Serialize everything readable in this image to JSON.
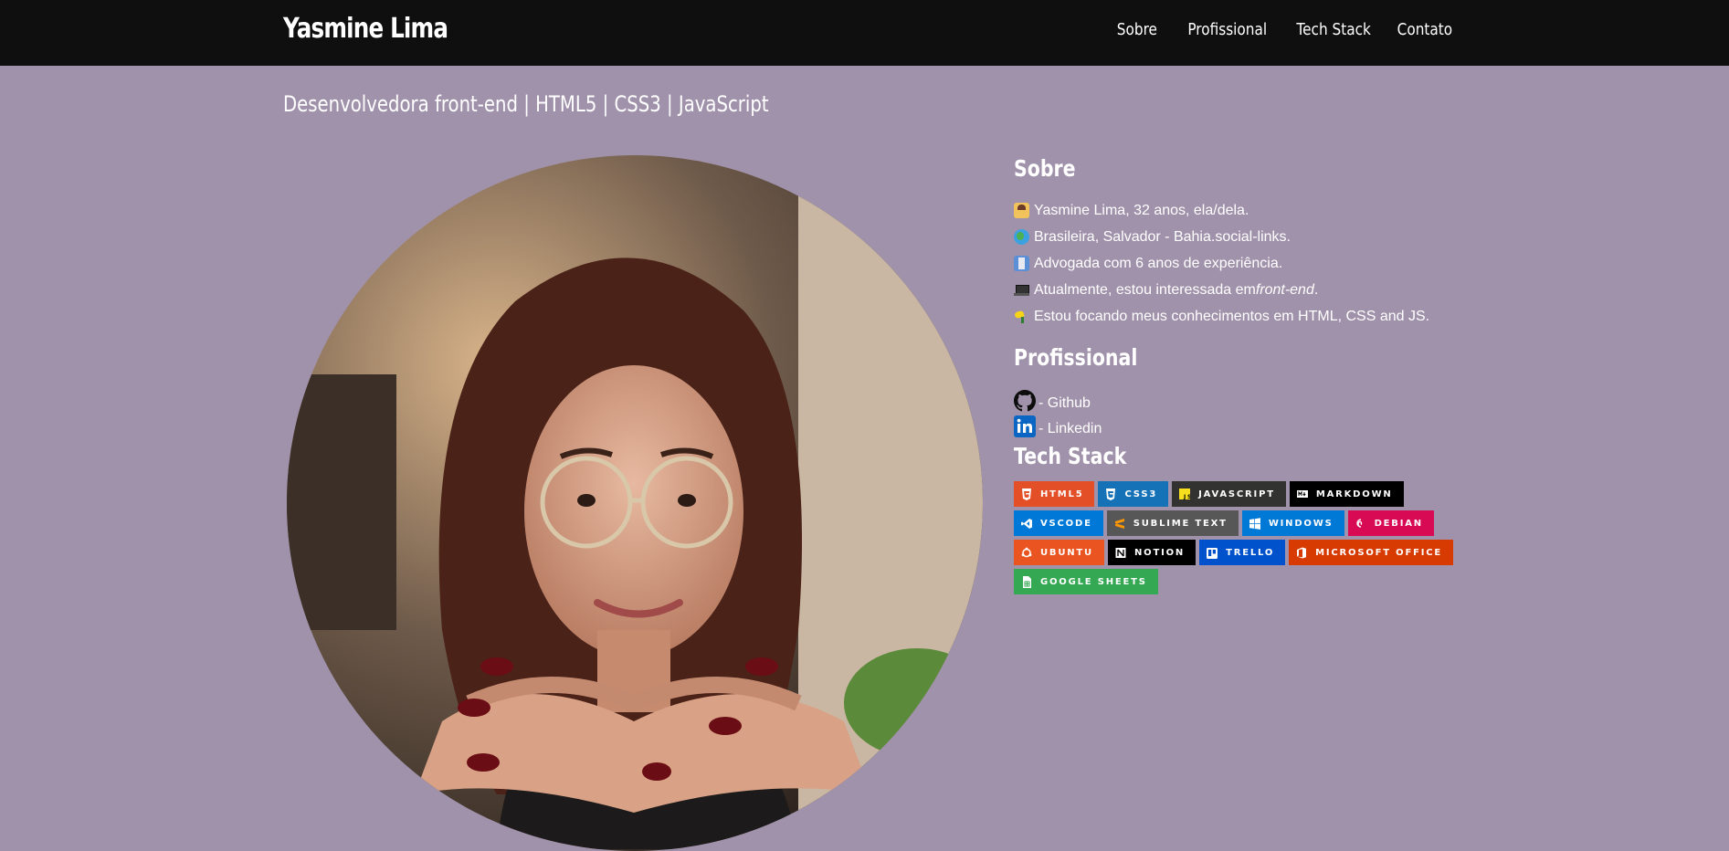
{
  "header": {
    "brand": "Yasmine Lima",
    "nav": [
      "Sobre",
      "Profissional",
      "Tech Stack",
      "Contato"
    ]
  },
  "tagline": "Desenvolvedora front-end | HTML5 | CSS3 | JavaScript",
  "photo": {
    "alt": "profile-photo"
  },
  "about": {
    "title": "Sobre",
    "items": [
      {
        "icon": "woman-technologist-icon",
        "text": "Yasmine Lima, 32 anos, ela/dela."
      },
      {
        "icon": "globe-icon",
        "text": "Brasileira, Salvador - Bahia.social-links."
      },
      {
        "icon": "judge-icon",
        "text": "Advogada com 6 anos de experiência."
      },
      {
        "icon": "laptop-icon",
        "text_before": "Atualmente, estou interessada em ",
        "text_italic": "front-end",
        "text_after": "."
      },
      {
        "icon": "bird-icon",
        "text": "Estou focando meus conhecimentos em HTML, CSS and JS."
      }
    ]
  },
  "profissional": {
    "title": "Profissional",
    "links": [
      {
        "icon": "github-icon",
        "label": "- Github"
      },
      {
        "icon": "linkedin-icon",
        "label": "- Linkedin"
      }
    ]
  },
  "tech_stack": {
    "title": "Tech Stack",
    "badges": [
      {
        "label": "HTML5",
        "color": "#e34f26"
      },
      {
        "label": "CSS3",
        "color": "#1572b6"
      },
      {
        "label": "JAVASCRIPT",
        "color": "#323330"
      },
      {
        "label": "MARKDOWN",
        "color": "#000000"
      },
      {
        "label": "VSCODE",
        "color": "#0078d7"
      },
      {
        "label": "SUBLIME TEXT",
        "color": "#575757"
      },
      {
        "label": "WINDOWS",
        "color": "#0078d6"
      },
      {
        "label": "DEBIAN",
        "color": "#d70a53"
      },
      {
        "label": "UBUNTU",
        "color": "#e95420"
      },
      {
        "label": "NOTION",
        "color": "#000000"
      },
      {
        "label": "TRELLO",
        "color": "#0052cc"
      },
      {
        "label": "MICROSOFT OFFICE",
        "color": "#d83b01"
      },
      {
        "label": "GOOGLE SHEETS",
        "color": "#34a853"
      }
    ]
  },
  "colors": {
    "background": "#a092aa",
    "header": "#0f0f0f"
  }
}
